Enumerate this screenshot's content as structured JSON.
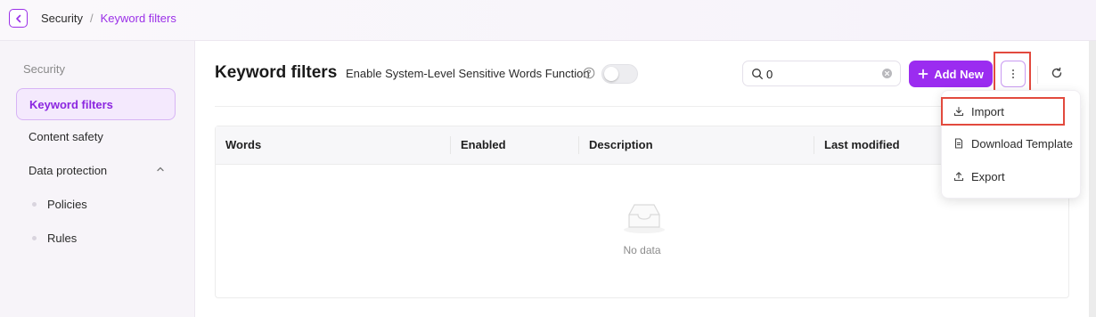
{
  "breadcrumb": {
    "root": "Security",
    "separator": "/",
    "current": "Keyword filters"
  },
  "sidebar": {
    "group_title": "Security",
    "items": [
      {
        "label": "Keyword filters",
        "active": true
      },
      {
        "label": "Content safety",
        "active": false
      },
      {
        "label": "Data protection",
        "active": false,
        "expanded": true
      }
    ],
    "sub_items": [
      {
        "label": "Policies"
      },
      {
        "label": "Rules"
      }
    ]
  },
  "header": {
    "title": "Keyword filters",
    "toggle_label": "Enable System-Level Sensitive Words Function",
    "toggle_on": false
  },
  "search": {
    "value": "0",
    "placeholder": ""
  },
  "toolbar": {
    "add_label": "Add New"
  },
  "table": {
    "columns": [
      "Words",
      "Enabled",
      "Description",
      "Last modified"
    ],
    "rows": [],
    "empty_text": "No data"
  },
  "menu": {
    "items": [
      {
        "label": "Import",
        "icon": "download-icon"
      },
      {
        "label": "Download Template",
        "icon": "file-icon"
      },
      {
        "label": "Export",
        "icon": "upload-icon"
      }
    ]
  },
  "colors": {
    "accent": "#9b2cf0",
    "highlight": "#e24a3e"
  }
}
